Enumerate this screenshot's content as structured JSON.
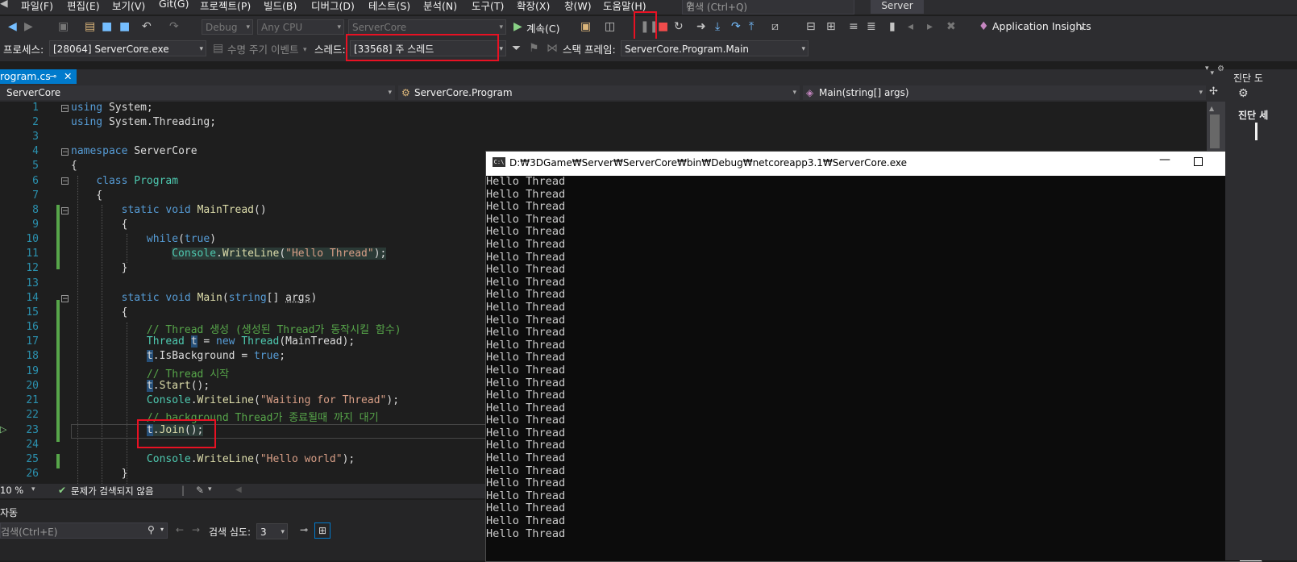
{
  "menu": [
    "파일(F)",
    "편집(E)",
    "보기(V)",
    "Git(G)",
    "프로젝트(P)",
    "빌드(B)",
    "디버그(D)",
    "테스트(S)",
    "분석(N)",
    "도구(T)",
    "확장(X)",
    "창(W)",
    "도움말(H)"
  ],
  "search": {
    "placeholder": "검색 (Ctrl+Q)"
  },
  "solution_name": "Server",
  "toolbar": {
    "config": "Debug",
    "platform": "Any CPU",
    "startup_project": "ServerCore",
    "continue_label": "계속(C)",
    "app_insights": "Application Insights"
  },
  "debug_bar": {
    "process_label": "프로세스:",
    "process_value": "[28064] ServerCore.exe",
    "lifecycle_label": "수명 주기 이벤트",
    "thread_label": "스레드:",
    "thread_value": "[33568] 주 스레드",
    "stackframe_label": "스택 프레임:",
    "stackframe_value": "ServerCore.Program.Main"
  },
  "tab": {
    "name": "rogram.cs"
  },
  "navbar": {
    "project": "ServerCore",
    "class": "ServerCore.Program",
    "member": "Main(string[] args)"
  },
  "editor": {
    "line_numbers": [
      "1",
      "2",
      "3",
      "4",
      "5",
      "6",
      "7",
      "8",
      "9",
      "10",
      "11",
      "12",
      "13",
      "14",
      "15",
      "16",
      "17",
      "18",
      "19",
      "20",
      "21",
      "22",
      "23",
      "24",
      "25",
      "26"
    ]
  },
  "status": {
    "zoom": "10 %",
    "issues": "문제가 검색되지 않음"
  },
  "bottom_panel": {
    "title": "자동",
    "search_placeholder": "검색(Ctrl+E)",
    "depth_label": "검색 심도:",
    "depth_value": "3"
  },
  "console": {
    "title": "D:₩3DGame₩Server₩ServerCore₩bin₩Debug₩netcoreapp3.1₩ServerCore.exe",
    "line_text": "Hello Thread",
    "line_count": 29
  },
  "right_panel": {
    "title": "진단 도",
    "tab": "진단 세"
  },
  "colors": {
    "accent": "#007acc",
    "highlight_box": "#e81123",
    "keyword": "#569cd6",
    "type": "#4ec9b0",
    "string": "#d69d85",
    "comment": "#57a64a"
  }
}
